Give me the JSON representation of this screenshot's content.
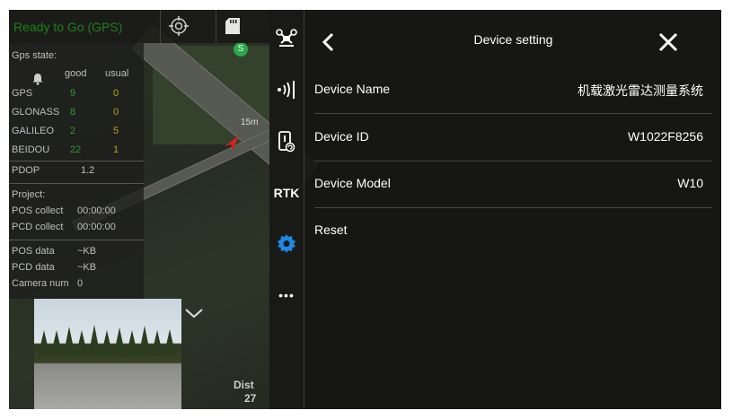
{
  "status": {
    "title": "Ready to Go (GPS)",
    "target_icon": "target-icon",
    "sd_icon": "sd-card-icon"
  },
  "gps_panel": {
    "heading": "Gps state:",
    "col_good": "good",
    "col_usual": "usual",
    "rows": [
      {
        "name": "GPS",
        "good": "9",
        "usual": "0"
      },
      {
        "name": "GLONASS",
        "good": "8",
        "usual": "0"
      },
      {
        "name": "GALILEO",
        "good": "2",
        "usual": "5"
      },
      {
        "name": "BEIDOU",
        "good": "22",
        "usual": "1"
      }
    ],
    "pdop_label": "PDOP",
    "pdop_value": "1.2",
    "project_label": "Project:",
    "pos_collect_label": "POS collect",
    "pos_collect_value": "00:00:00",
    "pcd_collect_label": "PCD collect",
    "pcd_collect_value": "00:00:00",
    "pos_data_label": "POS data",
    "pos_data_value": "~KB",
    "pcd_data_label": "PCD data",
    "pcd_data_value": "~KB",
    "camera_num_label": "Camera num",
    "camera_num_value": "0"
  },
  "map": {
    "distance_label": "Dist",
    "distance_value": "27",
    "scale_label": "15m"
  },
  "toolbar": {
    "rtk_label": "RTK",
    "more_label": "•••"
  },
  "dialog": {
    "title": "Device setting",
    "rows": [
      {
        "label": "Device Name",
        "value": "机载激光雷达测量系统"
      },
      {
        "label": "Device ID",
        "value": "W1022F8256"
      },
      {
        "label": "Device Model",
        "value": "W10"
      },
      {
        "label": "Reset",
        "value": ""
      }
    ]
  },
  "colors": {
    "status_green": "#1e7f1e",
    "settings_blue": "#1e88e5",
    "good_green": "#2f9a2f",
    "usual_yellow": "#b5a614"
  }
}
